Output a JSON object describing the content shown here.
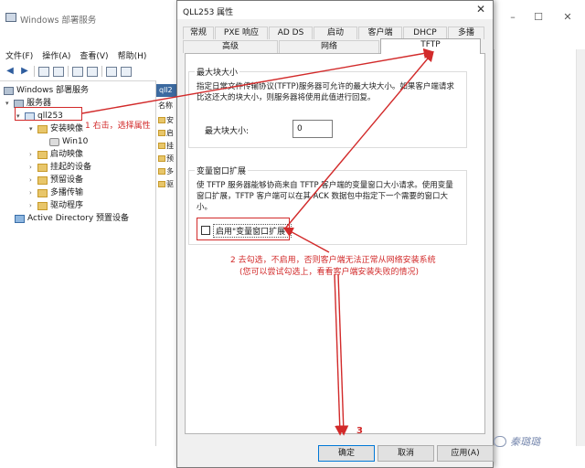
{
  "wds_window": {
    "title": "Windows 部署服务",
    "menu": [
      "文件(F)",
      "操作(A)",
      "查看(V)",
      "帮助(H)"
    ],
    "tree": {
      "root": "Windows 部署服务",
      "servers": "服务器",
      "server": "qll253",
      "install_images": "安装映像",
      "win10": "Win10",
      "boot_images": "启动映像",
      "pending": "挂起的设备",
      "prestaged": "预留设备",
      "multicast": "多播传输",
      "drivers": "驱动程序",
      "ad_prestaged": "Active Directory 预置设备"
    },
    "pane_header": "qll2",
    "pane_col": "名称",
    "pane_rows": [
      "安",
      "启",
      "挂",
      "预",
      "多",
      "驱"
    ]
  },
  "dialog": {
    "title": "QLL253 属性",
    "tabs_row1": [
      "常规",
      "PXE 响应",
      "AD DS",
      "启动",
      "客户端",
      "DHCP",
      "多播"
    ],
    "tabs_row2": [
      "高级",
      "网络",
      "TFTP"
    ],
    "block_group": {
      "legend": "最大块大小",
      "desc_line1": "指定日常文件传输协议(TFTP)服务器可允许的最大块大小。如果客户端请求",
      "desc_line2": "比这还大的块大小，则服务器将使用此值进行回复。",
      "label": "最大块大小:",
      "value": "0"
    },
    "window_group": {
      "legend": "变量窗口扩展",
      "desc_line1": "使 TFTP 服务器能够协商来自 TFTP 客户端的变量窗口大小请求。使用变量",
      "desc_line2": "窗口扩展，TFTP 客户端可以在其 ACK 数据包中指定下一个需要的窗口大",
      "desc_line3": "小。",
      "checkbox_label": "启用\"变量窗口扩展\"",
      "checked": false
    },
    "buttons": {
      "ok": "确定",
      "cancel": "取消",
      "apply": "应用(A)"
    }
  },
  "annotations": {
    "step1": "1 右击，选择属性",
    "step2_line1": "2 去勾选，不启用，否则客户端无法正常从网络安装系统",
    "step2_line2": "(您可以尝试勾选上，看看客户端安装失败的情况)",
    "step3": "3"
  },
  "watermark": "秦璐璐",
  "colors": {
    "annotation_red": "#d22a2a",
    "primary_blue": "#0078d7"
  }
}
